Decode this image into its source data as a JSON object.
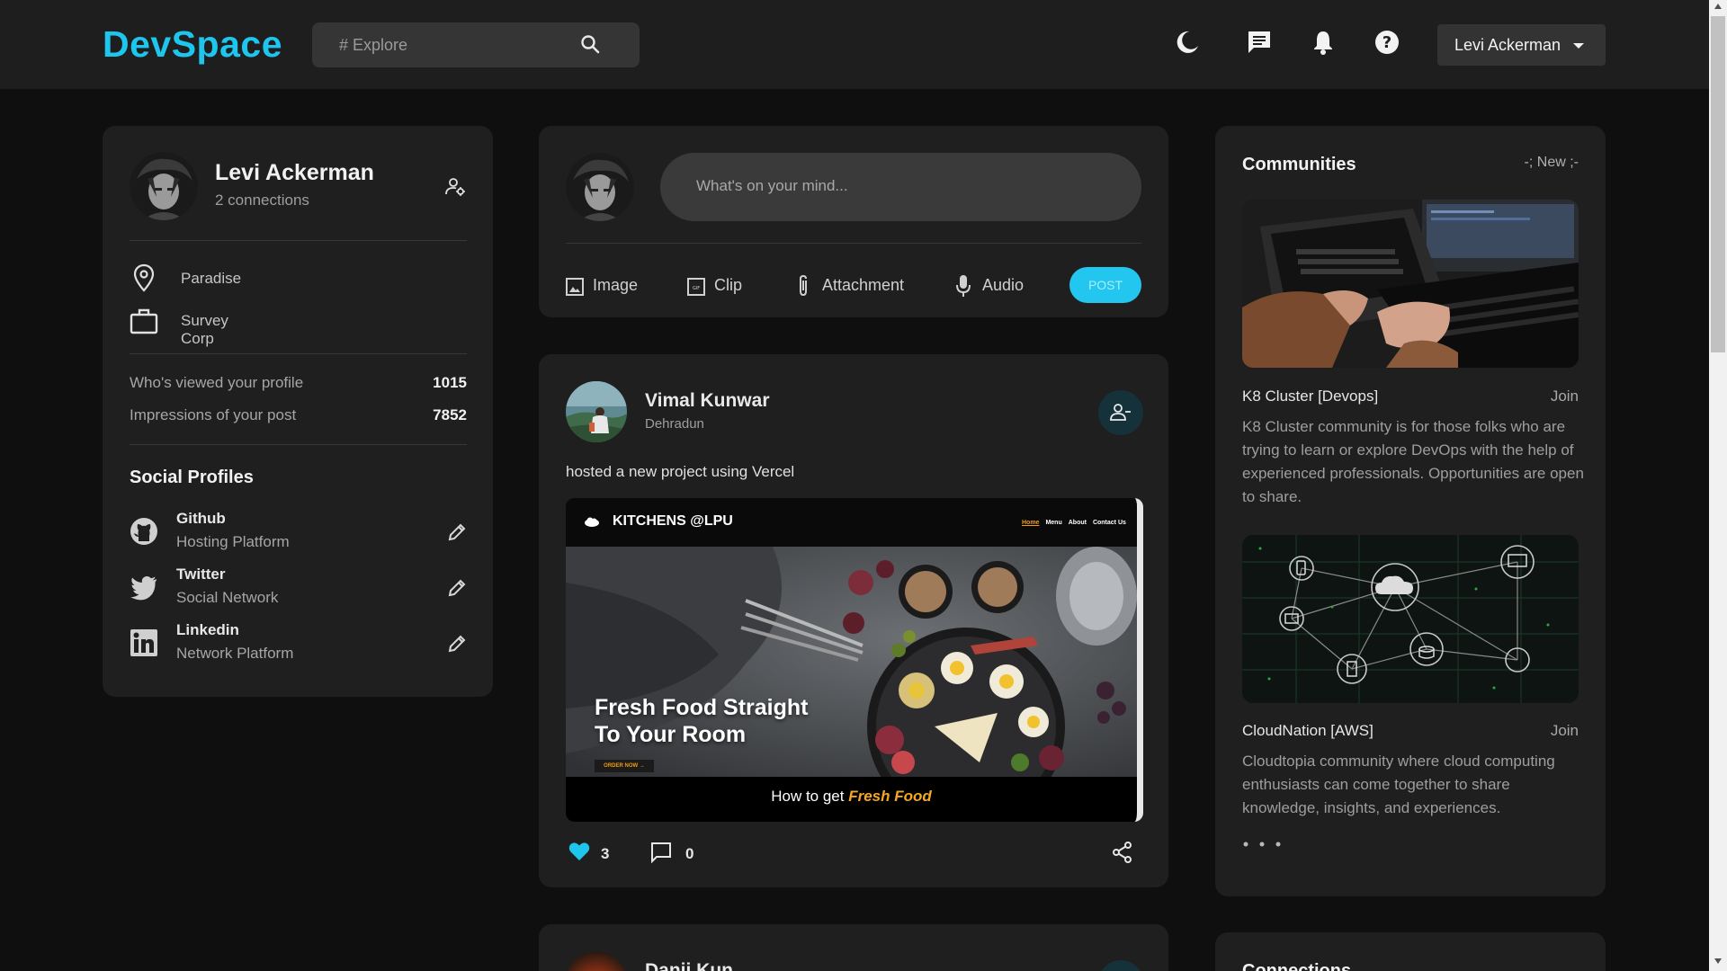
{
  "navbar": {
    "logo": "DevSpace",
    "search_placeholder": "# Explore",
    "user_name": "Levi Ackerman"
  },
  "profile": {
    "name": "Levi Ackerman",
    "connections": "2 connections",
    "location": "Paradise",
    "organization": "Survey Corp",
    "stats": [
      {
        "label": "Who's viewed your profile",
        "value": "1015"
      },
      {
        "label": "Impressions of your post",
        "value": "7852"
      }
    ],
    "social_title": "Social Profiles",
    "socials": [
      {
        "name": "Github",
        "sub": "Hosting Platform",
        "icon": "github-icon"
      },
      {
        "name": "Twitter",
        "sub": "Social Network",
        "icon": "twitter-icon"
      },
      {
        "name": "Linkedin",
        "sub": "Network Platform",
        "icon": "linkedin-icon"
      }
    ]
  },
  "composer": {
    "placeholder": "What's on your mind...",
    "actions": [
      {
        "label": "Image",
        "icon": "image-icon"
      },
      {
        "label": "Clip",
        "icon": "clip-icon"
      },
      {
        "label": "Attachment",
        "icon": "paperclip-icon"
      },
      {
        "label": "Audio",
        "icon": "microphone-icon"
      }
    ],
    "post_label": "POST"
  },
  "post": {
    "author": "Vimal Kunwar",
    "location": "Dehradun",
    "text": "hosted a new project using Vercel",
    "media": {
      "brand": "KITCHENS @LPU",
      "nav": [
        "Home",
        "Menu",
        "About",
        "Contact Us"
      ],
      "headline_line1": "Fresh Food Straight",
      "headline_line2": "To Your Room",
      "cta": "ORDER NOW →",
      "caption_prefix": "How to get ",
      "caption_highlight": "Fresh Food"
    },
    "likes": "3",
    "comments": "0"
  },
  "next_post": {
    "author": "Danji Kun"
  },
  "communities": {
    "title": "Communities",
    "new_label": "-; New ;-",
    "items": [
      {
        "name": "K8 Cluster [Devops]",
        "join": "Join",
        "description": "K8 Cluster community is for those folks who are trying to learn or explore DevOps with the help of experienced professionals. Opportunities are open to share."
      },
      {
        "name": "CloudNation [AWS]",
        "join": "Join",
        "description": "Cloudtopia community where cloud computing enthusiasts can come together to share knowledge, insights, and experiences."
      }
    ],
    "more": "• • •"
  },
  "connections": {
    "title": "Connections"
  },
  "colors": {
    "accent": "#22c6ee",
    "background": "#0f0f0f",
    "card": "#1f1f1f",
    "heart": "#1ec6ee"
  }
}
